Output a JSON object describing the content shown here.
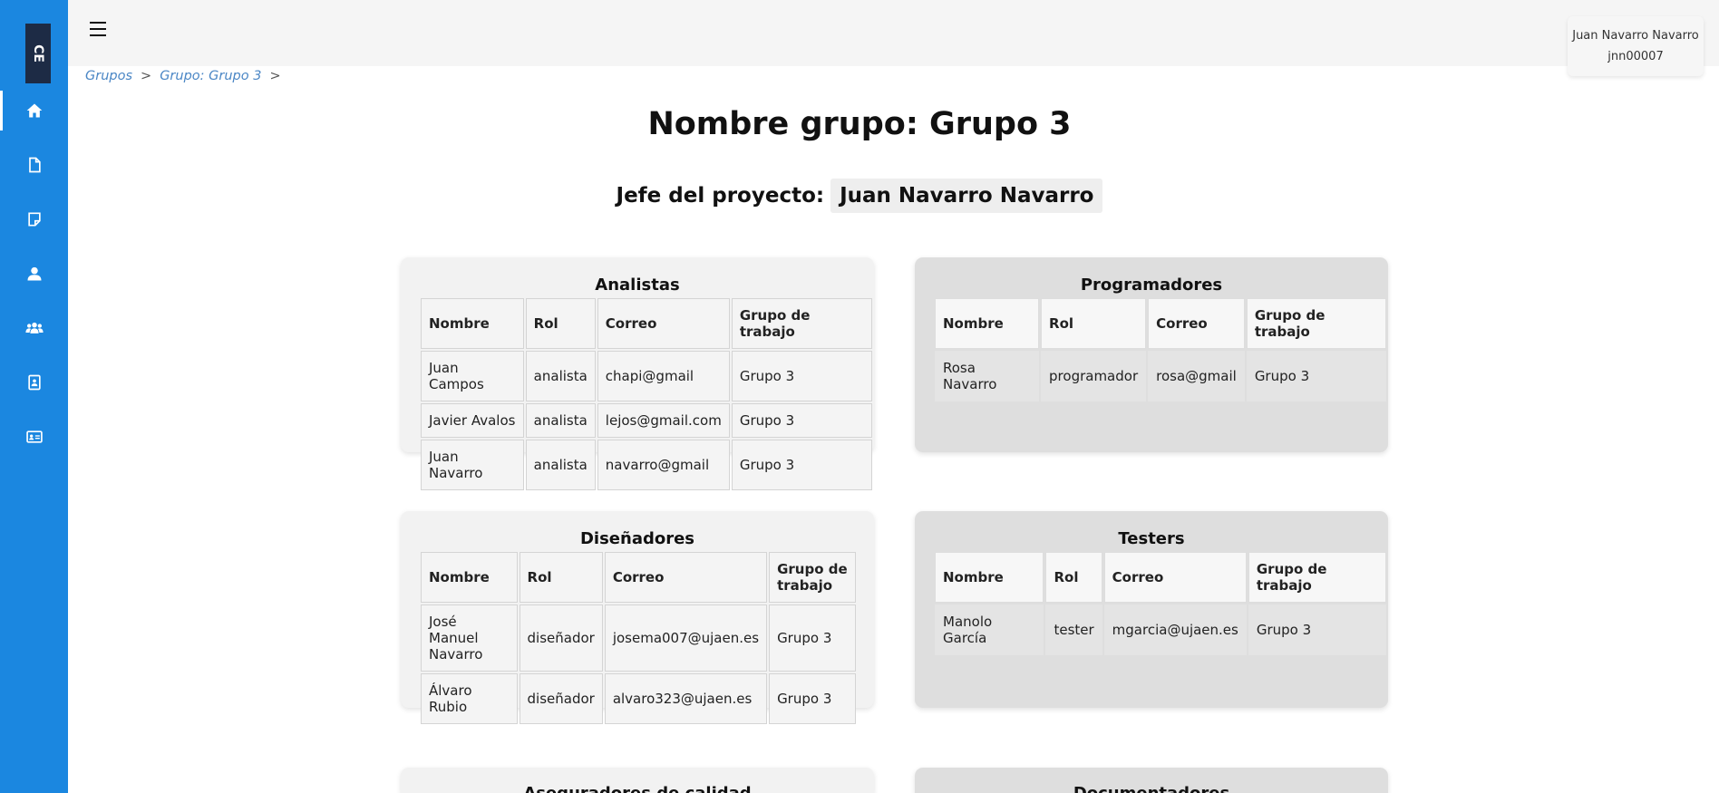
{
  "sidebar": {
    "logo_text": "CE",
    "items": [
      {
        "icon": "home-icon",
        "active": true
      },
      {
        "icon": "document-icon"
      },
      {
        "icon": "note-icon"
      },
      {
        "icon": "user-icon"
      },
      {
        "icon": "users-group-icon"
      },
      {
        "icon": "contact-book-icon"
      },
      {
        "icon": "id-card-icon"
      }
    ],
    "accent": "#1b87e0"
  },
  "user": {
    "name": "Juan Navarro Navarro",
    "username": "jnn00007"
  },
  "breadcrumb": {
    "items": [
      "Grupos",
      "Grupo: Grupo 3"
    ],
    "separator": ">"
  },
  "page": {
    "title": "Nombre grupo: Grupo 3",
    "chief_label": "Jefe del proyecto:",
    "chief_value": "Juan Navarro Navarro"
  },
  "columns": [
    "Nombre",
    "Rol",
    "Correo",
    "Grupo de trabajo"
  ],
  "sections": {
    "analistas": {
      "title": "Analistas",
      "rows": [
        [
          "Juan Campos",
          "analista",
          "chapi@gmail",
          "Grupo 3"
        ],
        [
          "Javier Avalos",
          "analista",
          "lejos@gmail.com",
          "Grupo 3"
        ],
        [
          "Juan Navarro",
          "analista",
          "navarro@gmail",
          "Grupo 3"
        ]
      ]
    },
    "programadores": {
      "title": "Programadores",
      "rows": [
        [
          "Rosa Navarro",
          "programador",
          "rosa@gmail",
          "Grupo 3"
        ]
      ]
    },
    "disenadores": {
      "title": "Diseñadores",
      "rows": [
        [
          "José Manuel Navarro",
          "diseñador",
          "josema007@ujaen.es",
          "Grupo 3"
        ],
        [
          "Álvaro Rubio",
          "diseñador",
          "alvaro323@ujaen.es",
          "Grupo 3"
        ]
      ]
    },
    "testers": {
      "title": "Testers",
      "rows": [
        [
          "Manolo García",
          "tester",
          "mgarcia@ujaen.es",
          "Grupo 3"
        ]
      ]
    },
    "aseguradores": {
      "title": "Aseguradores de calidad"
    },
    "documentadores": {
      "title": "Documentadores"
    }
  }
}
